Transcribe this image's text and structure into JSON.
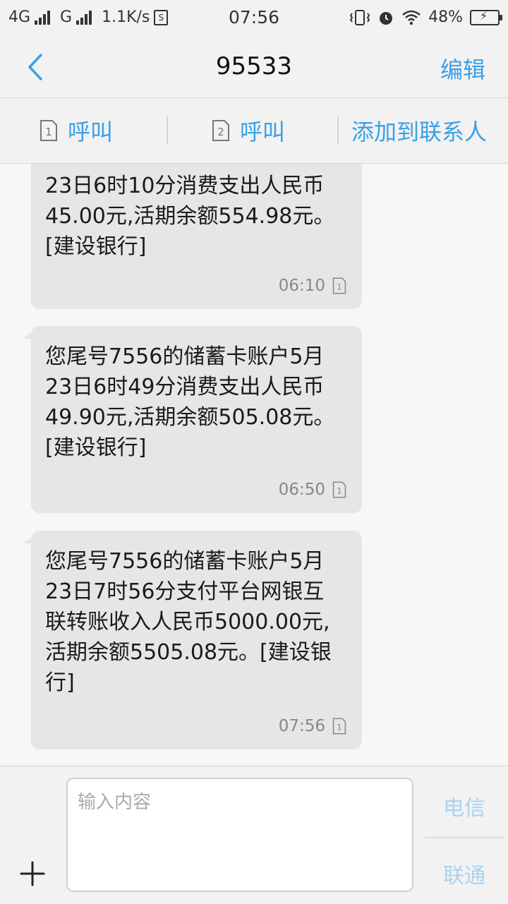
{
  "status_bar": {
    "network1": "4G",
    "network2": "G",
    "speed": "1.1K/s",
    "sim_badge": "S",
    "time": "07:56",
    "battery": "48%"
  },
  "header": {
    "back_icon": "chevron-left-icon",
    "title": "95533",
    "edit_label": "编辑"
  },
  "actions": {
    "call1_sim": "1",
    "call1_label": "呼叫",
    "call2_sim": "2",
    "call2_label": "呼叫",
    "add_contact_label": "添加到联系人"
  },
  "messages": [
    {
      "text": "23日6时10分消费支出人民币\n45.00元,活期余额554.98元。\n[建设银行]",
      "time": "06:10",
      "sim": "1"
    },
    {
      "text": "您尾号7556的储蓄卡账户5月\n23日6时49分消费支出人民币\n49.90元,活期余额505.08元。\n[建设银行]",
      "time": "06:50",
      "sim": "1"
    },
    {
      "text": "您尾号7556的储蓄卡账户5月\n23日7时56分支付平台网银互\n联转账收入人民币5000.00元,\n活期余额5505.08元。[建设银\n行]",
      "time": "07:56",
      "sim": "1"
    }
  ],
  "input": {
    "placeholder": "输入内容",
    "send_telecom": "电信",
    "send_unicom": "联通",
    "add_icon": "plus-icon"
  },
  "colors": {
    "accent": "#3aa0e8",
    "bubble": "#e6e6e6"
  }
}
